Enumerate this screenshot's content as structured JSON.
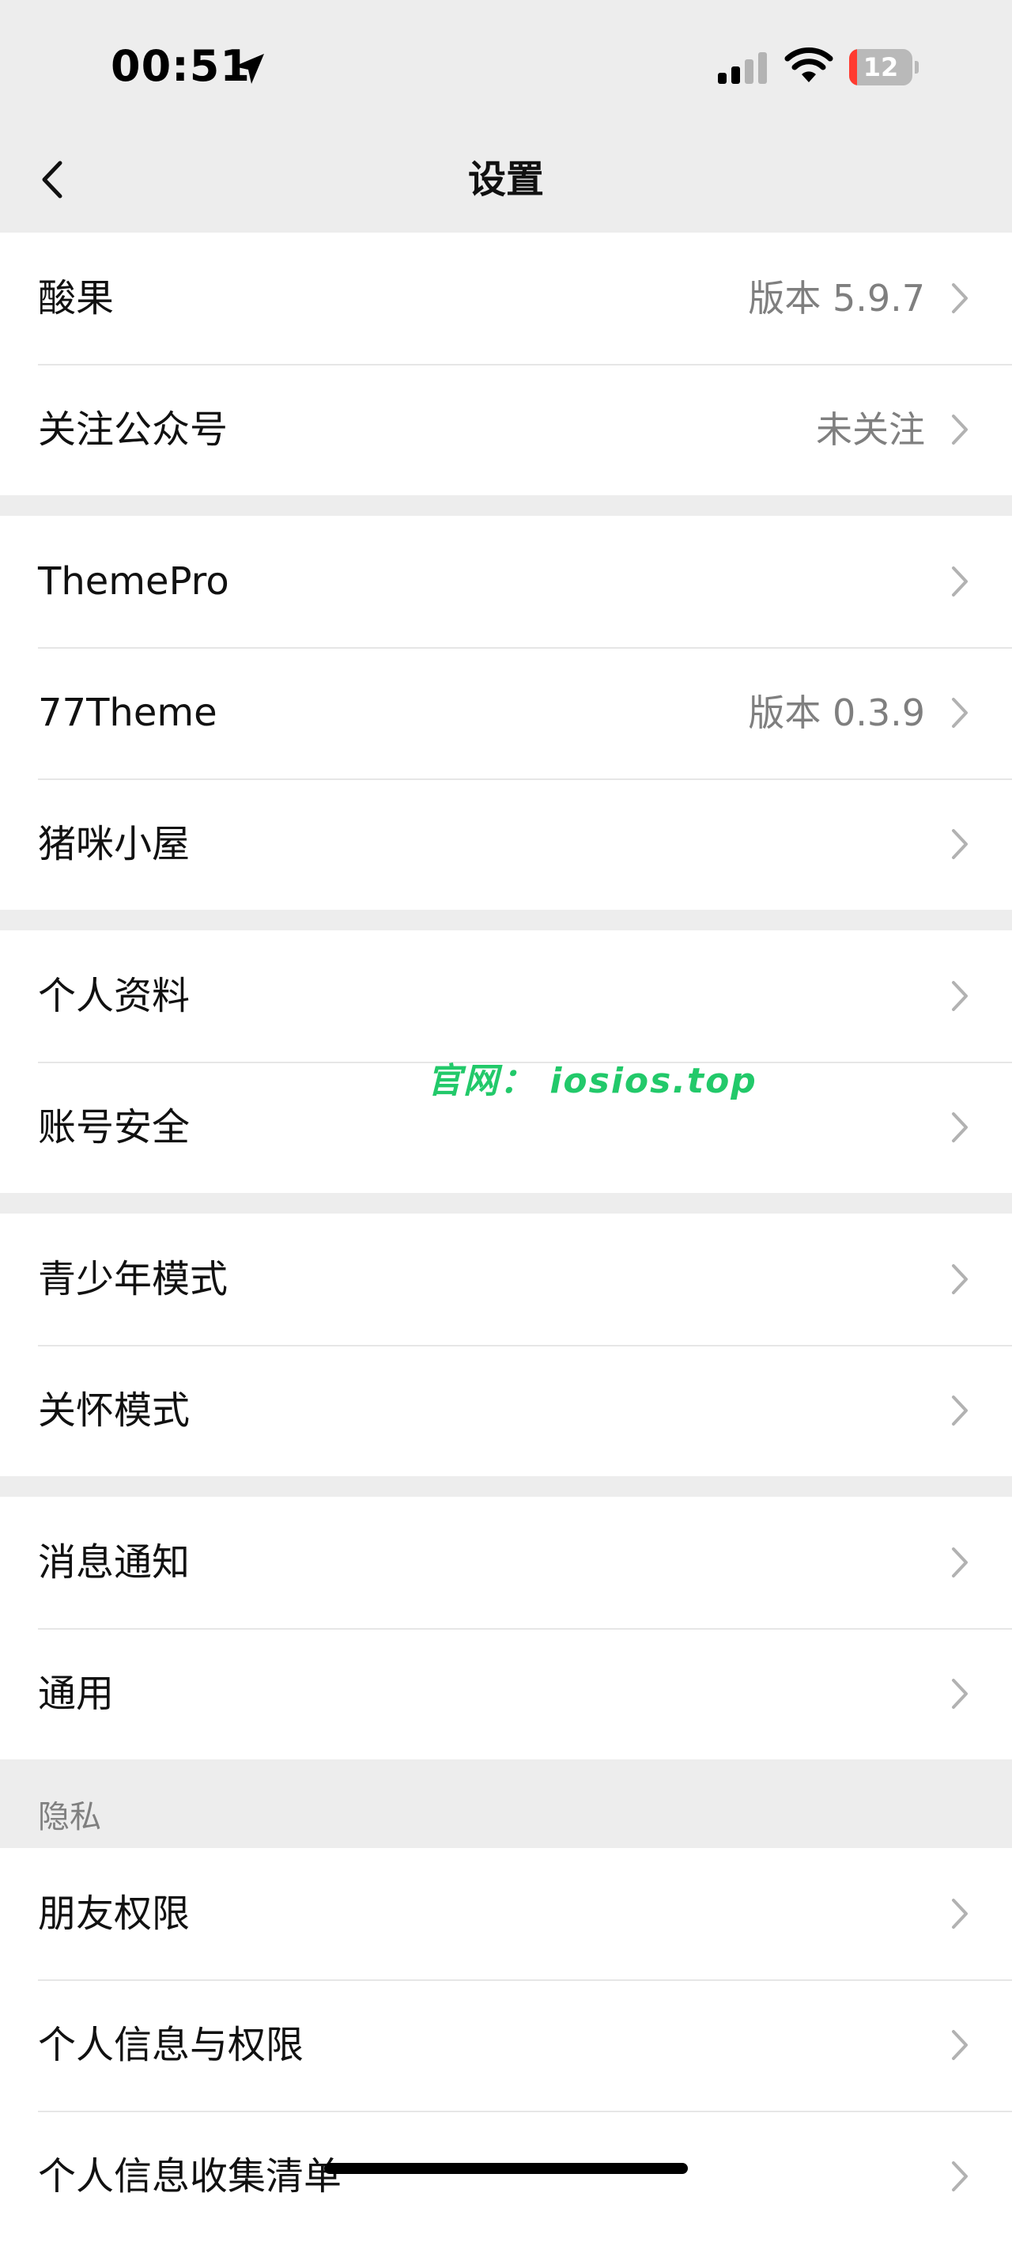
{
  "status_bar": {
    "time": "00:51",
    "battery_text": "12",
    "battery_level_fraction": 0.12,
    "icons": [
      "location-arrow-icon",
      "cellular-signal-icon",
      "wifi-icon",
      "battery-icon"
    ]
  },
  "nav": {
    "title": "设置",
    "back_icon": "chevron-left-icon"
  },
  "groups": [
    {
      "rows": [
        {
          "label": "酸果",
          "value": "版本 5.9.7"
        },
        {
          "label": "关注公众号",
          "value": "未关注"
        }
      ]
    },
    {
      "rows": [
        {
          "label": "ThemePro",
          "value": ""
        },
        {
          "label": "77Theme",
          "value": "版本 0.3.9"
        },
        {
          "label": "猪咪小屋",
          "value": ""
        }
      ]
    },
    {
      "rows": [
        {
          "label": "个人资料",
          "value": ""
        },
        {
          "label": "账号安全",
          "value": ""
        }
      ]
    },
    {
      "rows": [
        {
          "label": "青少年模式",
          "value": ""
        },
        {
          "label": "关怀模式",
          "value": ""
        }
      ]
    },
    {
      "rows": [
        {
          "label": "消息通知",
          "value": ""
        },
        {
          "label": "通用",
          "value": ""
        }
      ]
    },
    {
      "header": "隐私",
      "rows": [
        {
          "label": "朋友权限",
          "value": ""
        },
        {
          "label": "个人信息与权限",
          "value": ""
        },
        {
          "label": "个人信息收集清单",
          "value": ""
        }
      ]
    }
  ],
  "watermark": "官网： iosios.top",
  "colors": {
    "background": "#ededed",
    "row_background": "#ffffff",
    "secondary_text": "#7f7f7f",
    "watermark": "#22c96a",
    "battery_low": "#ff3b30"
  }
}
